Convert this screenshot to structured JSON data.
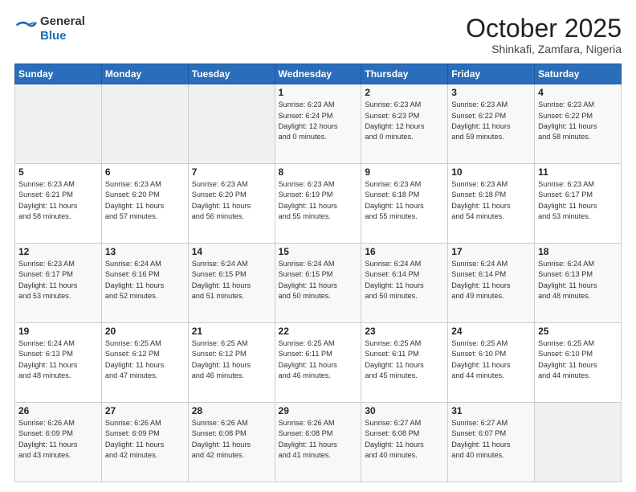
{
  "header": {
    "logo_line1": "General",
    "logo_line2": "Blue",
    "title": "October 2025",
    "subtitle": "Shinkafi, Zamfara, Nigeria"
  },
  "columns": [
    "Sunday",
    "Monday",
    "Tuesday",
    "Wednesday",
    "Thursday",
    "Friday",
    "Saturday"
  ],
  "weeks": [
    [
      {
        "num": "",
        "info": ""
      },
      {
        "num": "",
        "info": ""
      },
      {
        "num": "",
        "info": ""
      },
      {
        "num": "1",
        "info": "Sunrise: 6:23 AM\nSunset: 6:24 PM\nDaylight: 12 hours\nand 0 minutes."
      },
      {
        "num": "2",
        "info": "Sunrise: 6:23 AM\nSunset: 6:23 PM\nDaylight: 12 hours\nand 0 minutes."
      },
      {
        "num": "3",
        "info": "Sunrise: 6:23 AM\nSunset: 6:22 PM\nDaylight: 11 hours\nand 59 minutes."
      },
      {
        "num": "4",
        "info": "Sunrise: 6:23 AM\nSunset: 6:22 PM\nDaylight: 11 hours\nand 58 minutes."
      }
    ],
    [
      {
        "num": "5",
        "info": "Sunrise: 6:23 AM\nSunset: 6:21 PM\nDaylight: 11 hours\nand 58 minutes."
      },
      {
        "num": "6",
        "info": "Sunrise: 6:23 AM\nSunset: 6:20 PM\nDaylight: 11 hours\nand 57 minutes."
      },
      {
        "num": "7",
        "info": "Sunrise: 6:23 AM\nSunset: 6:20 PM\nDaylight: 11 hours\nand 56 minutes."
      },
      {
        "num": "8",
        "info": "Sunrise: 6:23 AM\nSunset: 6:19 PM\nDaylight: 11 hours\nand 55 minutes."
      },
      {
        "num": "9",
        "info": "Sunrise: 6:23 AM\nSunset: 6:18 PM\nDaylight: 11 hours\nand 55 minutes."
      },
      {
        "num": "10",
        "info": "Sunrise: 6:23 AM\nSunset: 6:18 PM\nDaylight: 11 hours\nand 54 minutes."
      },
      {
        "num": "11",
        "info": "Sunrise: 6:23 AM\nSunset: 6:17 PM\nDaylight: 11 hours\nand 53 minutes."
      }
    ],
    [
      {
        "num": "12",
        "info": "Sunrise: 6:23 AM\nSunset: 6:17 PM\nDaylight: 11 hours\nand 53 minutes."
      },
      {
        "num": "13",
        "info": "Sunrise: 6:24 AM\nSunset: 6:16 PM\nDaylight: 11 hours\nand 52 minutes."
      },
      {
        "num": "14",
        "info": "Sunrise: 6:24 AM\nSunset: 6:15 PM\nDaylight: 11 hours\nand 51 minutes."
      },
      {
        "num": "15",
        "info": "Sunrise: 6:24 AM\nSunset: 6:15 PM\nDaylight: 11 hours\nand 50 minutes."
      },
      {
        "num": "16",
        "info": "Sunrise: 6:24 AM\nSunset: 6:14 PM\nDaylight: 11 hours\nand 50 minutes."
      },
      {
        "num": "17",
        "info": "Sunrise: 6:24 AM\nSunset: 6:14 PM\nDaylight: 11 hours\nand 49 minutes."
      },
      {
        "num": "18",
        "info": "Sunrise: 6:24 AM\nSunset: 6:13 PM\nDaylight: 11 hours\nand 48 minutes."
      }
    ],
    [
      {
        "num": "19",
        "info": "Sunrise: 6:24 AM\nSunset: 6:13 PM\nDaylight: 11 hours\nand 48 minutes."
      },
      {
        "num": "20",
        "info": "Sunrise: 6:25 AM\nSunset: 6:12 PM\nDaylight: 11 hours\nand 47 minutes."
      },
      {
        "num": "21",
        "info": "Sunrise: 6:25 AM\nSunset: 6:12 PM\nDaylight: 11 hours\nand 46 minutes."
      },
      {
        "num": "22",
        "info": "Sunrise: 6:25 AM\nSunset: 6:11 PM\nDaylight: 11 hours\nand 46 minutes."
      },
      {
        "num": "23",
        "info": "Sunrise: 6:25 AM\nSunset: 6:11 PM\nDaylight: 11 hours\nand 45 minutes."
      },
      {
        "num": "24",
        "info": "Sunrise: 6:25 AM\nSunset: 6:10 PM\nDaylight: 11 hours\nand 44 minutes."
      },
      {
        "num": "25",
        "info": "Sunrise: 6:25 AM\nSunset: 6:10 PM\nDaylight: 11 hours\nand 44 minutes."
      }
    ],
    [
      {
        "num": "26",
        "info": "Sunrise: 6:26 AM\nSunset: 6:09 PM\nDaylight: 11 hours\nand 43 minutes."
      },
      {
        "num": "27",
        "info": "Sunrise: 6:26 AM\nSunset: 6:09 PM\nDaylight: 11 hours\nand 42 minutes."
      },
      {
        "num": "28",
        "info": "Sunrise: 6:26 AM\nSunset: 6:08 PM\nDaylight: 11 hours\nand 42 minutes."
      },
      {
        "num": "29",
        "info": "Sunrise: 6:26 AM\nSunset: 6:08 PM\nDaylight: 11 hours\nand 41 minutes."
      },
      {
        "num": "30",
        "info": "Sunrise: 6:27 AM\nSunset: 6:08 PM\nDaylight: 11 hours\nand 40 minutes."
      },
      {
        "num": "31",
        "info": "Sunrise: 6:27 AM\nSunset: 6:07 PM\nDaylight: 11 hours\nand 40 minutes."
      },
      {
        "num": "",
        "info": ""
      }
    ]
  ]
}
